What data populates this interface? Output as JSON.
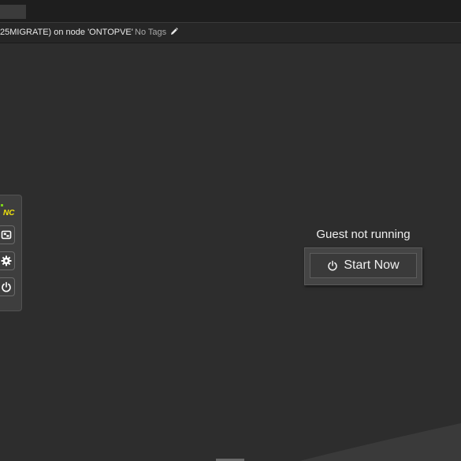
{
  "header": {
    "title": "25MIGRATE) on node 'ONTOPVE'",
    "tags_label": "No Tags"
  },
  "sidebar": {
    "logo_text": "NC",
    "buttons": [
      "extra-keys",
      "settings",
      "power"
    ]
  },
  "guest": {
    "status_text": "Guest not running",
    "start_label": "Start Now"
  },
  "colors": {
    "background": "#2d2d2d",
    "topbar": "#1e1e1e",
    "logo_green": "#7bd21a",
    "logo_yellow": "#f2e40c"
  }
}
